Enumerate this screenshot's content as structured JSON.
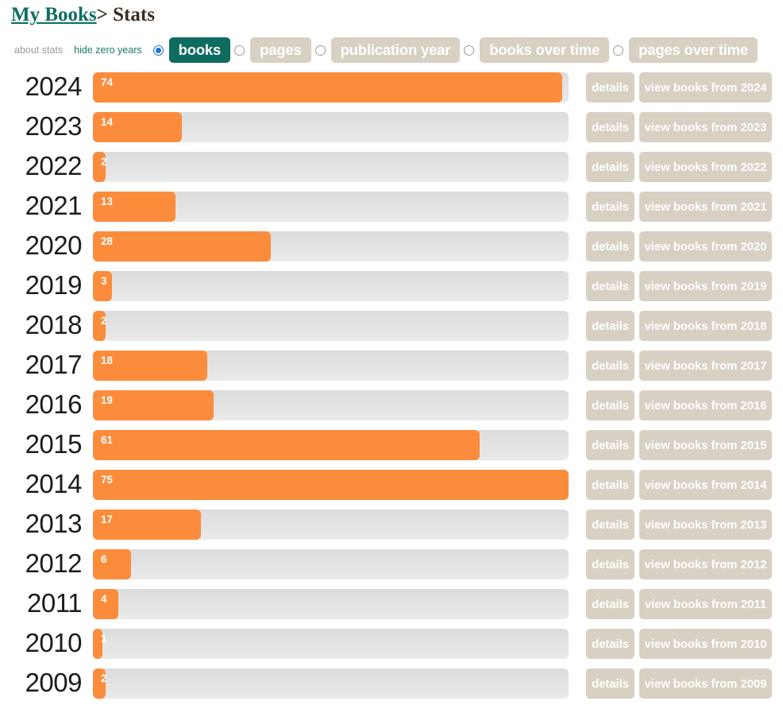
{
  "header": {
    "title_primary": "My Books",
    "title_separator": ">",
    "title_secondary": "Stats",
    "primary_color": "#0e6d62",
    "secondary_color": "#3a2d22"
  },
  "toolbar": {
    "about_stats_label": "about stats",
    "hide_zero_years_label": "hide zero years",
    "options": [
      {
        "label": "books",
        "checked": true
      },
      {
        "label": "pages",
        "checked": false
      },
      {
        "label": "publication year",
        "checked": false
      },
      {
        "label": "books over time",
        "checked": false
      },
      {
        "label": "pages over time",
        "checked": false
      }
    ],
    "active_pill_color": "#0e6b5f",
    "inactive_pill_color": "#d8d0c2",
    "radio_checked_color": "#1f74d8"
  },
  "chart_data": {
    "type": "bar",
    "title": "My Books > Stats",
    "xlabel": "",
    "ylabel": "",
    "orientation": "horizontal",
    "metric": "books",
    "bar_color": "#fb8c3c",
    "track_color": "#e2e2e2",
    "xlim": [
      0,
      75
    ],
    "grid": false,
    "legend": "none",
    "categories": [
      "2024",
      "2023",
      "2022",
      "2021",
      "2020",
      "2019",
      "2018",
      "2017",
      "2016",
      "2015",
      "2014",
      "2013",
      "2012",
      "2011",
      "2010",
      "2009"
    ],
    "values": [
      74,
      14,
      2,
      13,
      28,
      3,
      2,
      18,
      19,
      61,
      75,
      17,
      6,
      4,
      1,
      2
    ]
  },
  "rows": [
    {
      "year": "2024",
      "value": "74",
      "details_label": "details",
      "view_label": "view books from 2024"
    },
    {
      "year": "2023",
      "value": "14",
      "details_label": "details",
      "view_label": "view books from 2023"
    },
    {
      "year": "2022",
      "value": "2",
      "details_label": "details",
      "view_label": "view books from 2022"
    },
    {
      "year": "2021",
      "value": "13",
      "details_label": "details",
      "view_label": "view books from 2021"
    },
    {
      "year": "2020",
      "value": "28",
      "details_label": "details",
      "view_label": "view books from 2020"
    },
    {
      "year": "2019",
      "value": "3",
      "details_label": "details",
      "view_label": "view books from 2019"
    },
    {
      "year": "2018",
      "value": "2",
      "details_label": "details",
      "view_label": "view books from 2018"
    },
    {
      "year": "2017",
      "value": "18",
      "details_label": "details",
      "view_label": "view books from 2017"
    },
    {
      "year": "2016",
      "value": "19",
      "details_label": "details",
      "view_label": "view books from 2016"
    },
    {
      "year": "2015",
      "value": "61",
      "details_label": "details",
      "view_label": "view books from 2015"
    },
    {
      "year": "2014",
      "value": "75",
      "details_label": "details",
      "view_label": "view books from 2014"
    },
    {
      "year": "2013",
      "value": "17",
      "details_label": "details",
      "view_label": "view books from 2013"
    },
    {
      "year": "2012",
      "value": "6",
      "details_label": "details",
      "view_label": "view books from 2012"
    },
    {
      "year": "2011",
      "value": "4",
      "details_label": "details",
      "view_label": "view books from 2011"
    },
    {
      "year": "2010",
      "value": "1",
      "details_label": "details",
      "view_label": "view books from 2010"
    },
    {
      "year": "2009",
      "value": "2",
      "details_label": "details",
      "view_label": "view books from 2009"
    }
  ]
}
